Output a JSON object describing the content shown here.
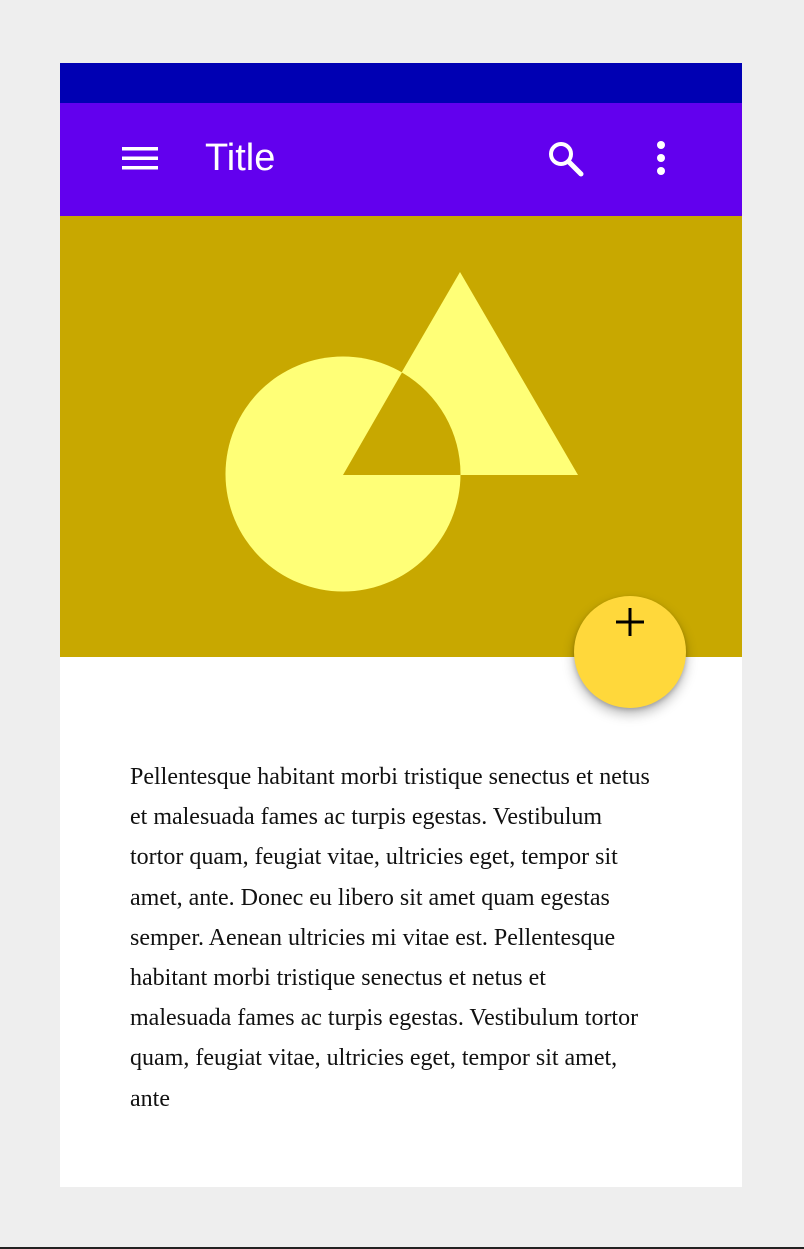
{
  "colors": {
    "page_background": "#eeeeee",
    "status_bar": "#0000b3",
    "app_bar": "#6200ee",
    "hero_background": "#c8a800",
    "hero_shapes": "#ffff77",
    "fab": "#ffd83b",
    "fab_icon": "#000000",
    "app_bar_text": "#ffffff"
  },
  "app_bar": {
    "title": "Title",
    "leading_icon": "menu-icon",
    "actions": [
      "search-icon",
      "more-vertical-icon"
    ]
  },
  "hero": {
    "image": "circle-and-triangle-illustration"
  },
  "fab": {
    "icon": "plus-icon"
  },
  "content": {
    "body": "Pellentesque habitant morbi tristique senectus et netus et malesuada fames ac turpis egestas. Vestibulum tortor quam, feugiat vitae, ultricies eget, tempor sit amet, ante. Donec eu libero sit amet quam egestas semper. Aenean ultricies mi vitae est. Pellentesque habitant morbi tristique senectus et netus et malesuada fames ac turpis egestas. Vestibulum tortor quam, feugiat vitae, ultricies eget, tempor sit amet, ante"
  }
}
